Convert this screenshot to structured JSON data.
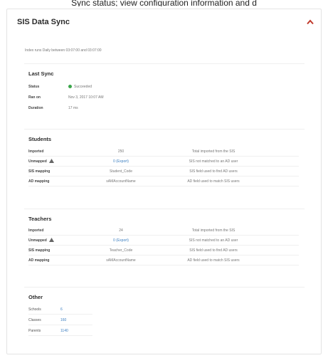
{
  "page_caption": "Sync status; view configuration information and d",
  "panel": {
    "title": "SIS Data Sync",
    "schedule_text": "Index runs Daily between 03:07:00 and 03:07:00"
  },
  "last_sync": {
    "title": "Last Sync",
    "rows": [
      {
        "label": "Status",
        "value": "Succeeded"
      },
      {
        "label": "Ran on",
        "value": "Nov 3, 2017 10:07 AM"
      },
      {
        "label": "Duration",
        "value": "17 ms"
      }
    ]
  },
  "students": {
    "title": "Students",
    "rows": [
      {
        "label": "Imported",
        "value": "250",
        "desc": "Total imported from the SIS"
      },
      {
        "label": "Unmapped",
        "value": "0 (Export)",
        "desc": "SIS not matched to an AD user"
      },
      {
        "label": "SIS mapping",
        "value": "Student_Code",
        "desc": "SIS field used to find AD users"
      },
      {
        "label": "AD mapping",
        "value": "sAMAccountName",
        "desc": "AD field used to match SIS users"
      }
    ]
  },
  "teachers": {
    "title": "Teachers",
    "rows": [
      {
        "label": "Imported",
        "value": "24",
        "desc": "Total imported from the SIS"
      },
      {
        "label": "Unmapped",
        "value": "0 (Export)",
        "desc": "SIS not matched to an AD user"
      },
      {
        "label": "SIS mapping",
        "value": "Teacher_Code",
        "desc": "SIS field used to find AD users"
      },
      {
        "label": "AD mapping",
        "value": "sAMAccountName",
        "desc": "AD field used to match SIS users"
      }
    ]
  },
  "other": {
    "title": "Other",
    "rows": [
      {
        "label": "Schools",
        "value": "6"
      },
      {
        "label": "Classes",
        "value": "160"
      },
      {
        "label": "Parents",
        "value": "1140"
      }
    ]
  },
  "colors": {
    "success": "#3aa54a",
    "link": "#3d7fc1",
    "collapse": "#c0392b"
  }
}
